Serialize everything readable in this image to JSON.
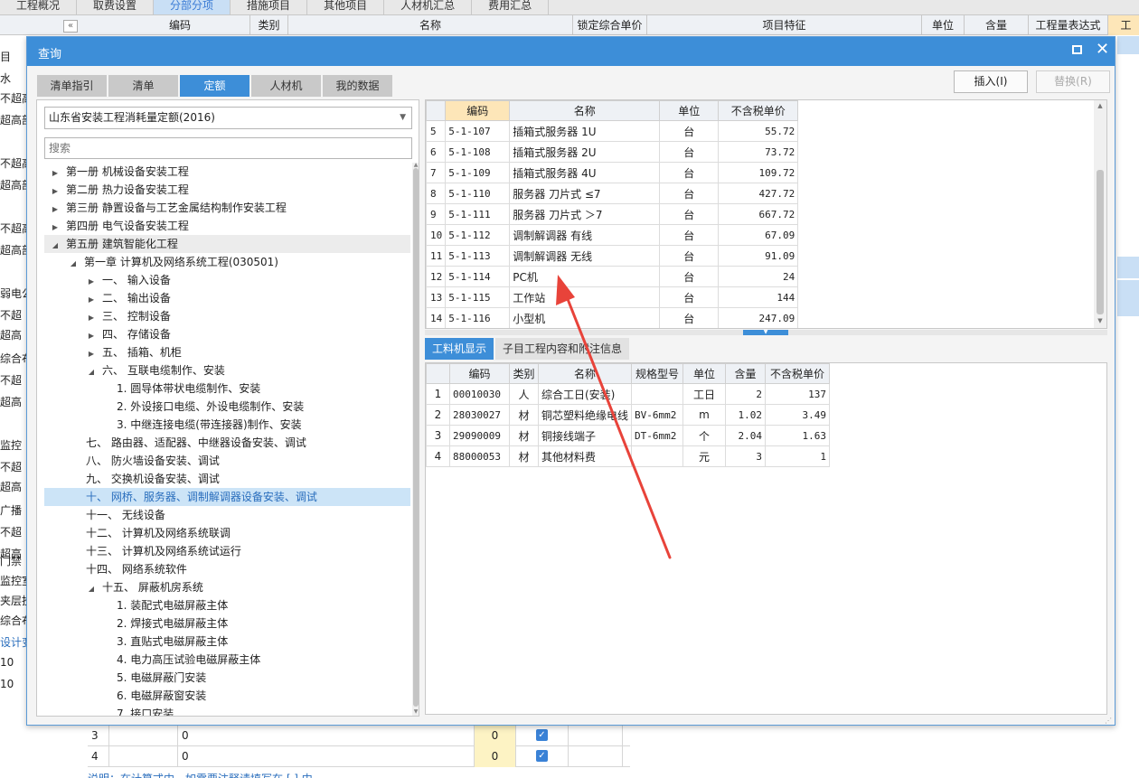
{
  "app": {
    "top_tabs": [
      "工程概况",
      "取费设置",
      "分部分项",
      "措施项目",
      "其他项目",
      "人材机汇总",
      "费用汇总"
    ],
    "active_top_tab": 2,
    "grid_header": {
      "code": "编码",
      "type": "类别",
      "name": "名称",
      "locked_price": "锁定综合单价",
      "feature": "项目特征",
      "unit": "单位",
      "qty": "含量",
      "expr": "工程量表达式",
      "extra": "工"
    },
    "left_strip": [
      {
        "text": "目",
        "blue": false
      },
      {
        "text": "水",
        "blue": false
      },
      {
        "text": "不超高",
        "blue": false
      },
      {
        "text": "超高部",
        "blue": false
      },
      {
        "text": "不超高",
        "blue": false
      },
      {
        "text": "超高部",
        "blue": false
      },
      {
        "text": "不超高",
        "blue": false
      },
      {
        "text": "超高部",
        "blue": false
      },
      {
        "text": "弱电公",
        "blue": false
      },
      {
        "text": "不超",
        "blue": false
      },
      {
        "text": "超高",
        "blue": false
      },
      {
        "text": "综合布",
        "blue": false
      },
      {
        "text": "不超",
        "blue": false
      },
      {
        "text": "超高",
        "blue": false
      },
      {
        "text": "监控",
        "blue": false
      },
      {
        "text": "不超",
        "blue": false
      },
      {
        "text": "超高",
        "blue": false
      },
      {
        "text": "广播",
        "blue": false
      },
      {
        "text": "不超",
        "blue": false
      },
      {
        "text": "超高",
        "blue": false
      },
      {
        "text": "门禁",
        "blue": false
      },
      {
        "text": "监控室",
        "blue": false
      },
      {
        "text": "夹层投",
        "blue": false
      },
      {
        "text": "综合布",
        "blue": false
      },
      {
        "text": "设计变",
        "blue": true
      },
      {
        "text": "10",
        "blue": false
      },
      {
        "text": "10",
        "blue": false
      }
    ],
    "bottom_rows": [
      {
        "num": "3",
        "value": "0",
        "zero": "0"
      },
      {
        "num": "4",
        "value": "0",
        "zero": "0"
      }
    ],
    "bottom_note": "说明：在计算式中，如需要注释请填写在 [ ] 中"
  },
  "dialog": {
    "title": "查询",
    "tabs": [
      "清单指引",
      "清单",
      "定额",
      "人材机",
      "我的数据"
    ],
    "active_tab": 2,
    "insert_label": "插入(I)",
    "replace_label": "替换(R)",
    "library": "山东省安装工程消耗量定额(2016)",
    "search_placeholder": "搜索",
    "tree": [
      {
        "label": "第一册 机械设备安装工程",
        "indent": 0,
        "toggle": "collapsed"
      },
      {
        "label": "第二册 热力设备安装工程",
        "indent": 0,
        "toggle": "collapsed"
      },
      {
        "label": "第三册 静置设备与工艺金属结构制作安装工程",
        "indent": 0,
        "toggle": "collapsed"
      },
      {
        "label": "第四册 电气设备安装工程",
        "indent": 0,
        "toggle": "collapsed"
      },
      {
        "label": "第五册 建筑智能化工程",
        "indent": 0,
        "toggle": "expanded",
        "state": "expanded"
      },
      {
        "label": "第一章 计算机及网络系统工程(030501)",
        "indent": 1,
        "toggle": "expanded"
      },
      {
        "label": "一、 输入设备",
        "indent": 2,
        "toggle": "collapsed"
      },
      {
        "label": "二、 输出设备",
        "indent": 2,
        "toggle": "collapsed"
      },
      {
        "label": "三、 控制设备",
        "indent": 2,
        "toggle": "collapsed"
      },
      {
        "label": "四、 存储设备",
        "indent": 2,
        "toggle": "collapsed"
      },
      {
        "label": "五、 插箱、机柜",
        "indent": 2,
        "toggle": "collapsed"
      },
      {
        "label": "六、 互联电缆制作、安装",
        "indent": 2,
        "toggle": "expanded"
      },
      {
        "label": "1. 圆导体带状电缆制作、安装",
        "indent": 3,
        "toggle": "none"
      },
      {
        "label": "2. 外设接口电缆、外设电缆制作、安装",
        "indent": 3,
        "toggle": "none"
      },
      {
        "label": "3. 中继连接电缆(带连接器)制作、安装",
        "indent": 3,
        "toggle": "none"
      },
      {
        "label": "七、 路由器、适配器、中继器设备安装、调试",
        "indent": 2,
        "toggle": "none"
      },
      {
        "label": "八、 防火墙设备安装、调试",
        "indent": 2,
        "toggle": "none"
      },
      {
        "label": "九、 交换机设备安装、调试",
        "indent": 2,
        "toggle": "none"
      },
      {
        "label": "十、 网桥、服务器、调制解调器设备安装、调试",
        "indent": 2,
        "toggle": "none",
        "state": "selected"
      },
      {
        "label": "十一、 无线设备",
        "indent": 2,
        "toggle": "none"
      },
      {
        "label": "十二、 计算机及网络系统联调",
        "indent": 2,
        "toggle": "none"
      },
      {
        "label": "十三、 计算机及网络系统试运行",
        "indent": 2,
        "toggle": "none"
      },
      {
        "label": "十四、 网络系统软件",
        "indent": 2,
        "toggle": "none"
      },
      {
        "label": "十五、 屏蔽机房系统",
        "indent": 2,
        "toggle": "expanded"
      },
      {
        "label": "1. 装配式电磁屏蔽主体",
        "indent": 3,
        "toggle": "none"
      },
      {
        "label": "2. 焊接式电磁屏蔽主体",
        "indent": 3,
        "toggle": "none"
      },
      {
        "label": "3. 直贴式电磁屏蔽主体",
        "indent": 3,
        "toggle": "none"
      },
      {
        "label": "4. 电力高压试验电磁屏蔽主体",
        "indent": 3,
        "toggle": "none"
      },
      {
        "label": "5. 电磁屏蔽门安装",
        "indent": 3,
        "toggle": "none"
      },
      {
        "label": "6. 电磁屏蔽窗安装",
        "indent": 3,
        "toggle": "none"
      },
      {
        "label": "7. 接口安装",
        "indent": 3,
        "toggle": "none"
      }
    ],
    "quota_table": {
      "headers": [
        "编码",
        "名称",
        "单位",
        "不含税单价"
      ],
      "rows": [
        {
          "n": "5",
          "code": "5-1-107",
          "name": "插箱式服务器 1U",
          "unit": "台",
          "price": "55.72"
        },
        {
          "n": "6",
          "code": "5-1-108",
          "name": "插箱式服务器 2U",
          "unit": "台",
          "price": "73.72"
        },
        {
          "n": "7",
          "code": "5-1-109",
          "name": "插箱式服务器 4U",
          "unit": "台",
          "price": "109.72"
        },
        {
          "n": "8",
          "code": "5-1-110",
          "name": "服务器 刀片式 ≤7",
          "unit": "台",
          "price": "427.72"
        },
        {
          "n": "9",
          "code": "5-1-111",
          "name": "服务器 刀片式 ＞7",
          "unit": "台",
          "price": "667.72"
        },
        {
          "n": "10",
          "code": "5-1-112",
          "name": "调制解调器 有线",
          "unit": "台",
          "price": "67.09"
        },
        {
          "n": "11",
          "code": "5-1-113",
          "name": "调制解调器 无线",
          "unit": "台",
          "price": "91.09"
        },
        {
          "n": "12",
          "code": "5-1-114",
          "name": "PC机",
          "unit": "台",
          "price": "24"
        },
        {
          "n": "13",
          "code": "5-1-115",
          "name": "工作站",
          "unit": "台",
          "price": "144"
        },
        {
          "n": "14",
          "code": "5-1-116",
          "name": "小型机",
          "unit": "台",
          "price": "247.09"
        }
      ]
    },
    "lower_tabs": [
      "工料机显示",
      "子目工程内容和附注信息"
    ],
    "active_lower_tab": 0,
    "material_table": {
      "headers": [
        "编码",
        "类别",
        "名称",
        "规格型号",
        "单位",
        "含量",
        "不含税单价"
      ],
      "rows": [
        {
          "n": "1",
          "code": "00010030",
          "type": "人",
          "name": "综合工日(安装)",
          "spec": "",
          "unit": "工日",
          "qty": "2",
          "price": "137"
        },
        {
          "n": "2",
          "code": "28030027",
          "type": "材",
          "name": "铜芯塑料绝缘电线",
          "spec": "BV-6mm2",
          "unit": "m",
          "qty": "1.02",
          "price": "3.49"
        },
        {
          "n": "3",
          "code": "29090009",
          "type": "材",
          "name": "铜接线端子",
          "spec": "DT-6mm2",
          "unit": "个",
          "qty": "2.04",
          "price": "1.63"
        },
        {
          "n": "4",
          "code": "88000053",
          "type": "材",
          "name": "其他材料费",
          "spec": "",
          "unit": "元",
          "qty": "3",
          "price": "1"
        }
      ]
    }
  },
  "colors": {
    "accent": "#3d8ed8",
    "selection": "#cce4f7",
    "annotation_arrow": "#e8433a"
  }
}
